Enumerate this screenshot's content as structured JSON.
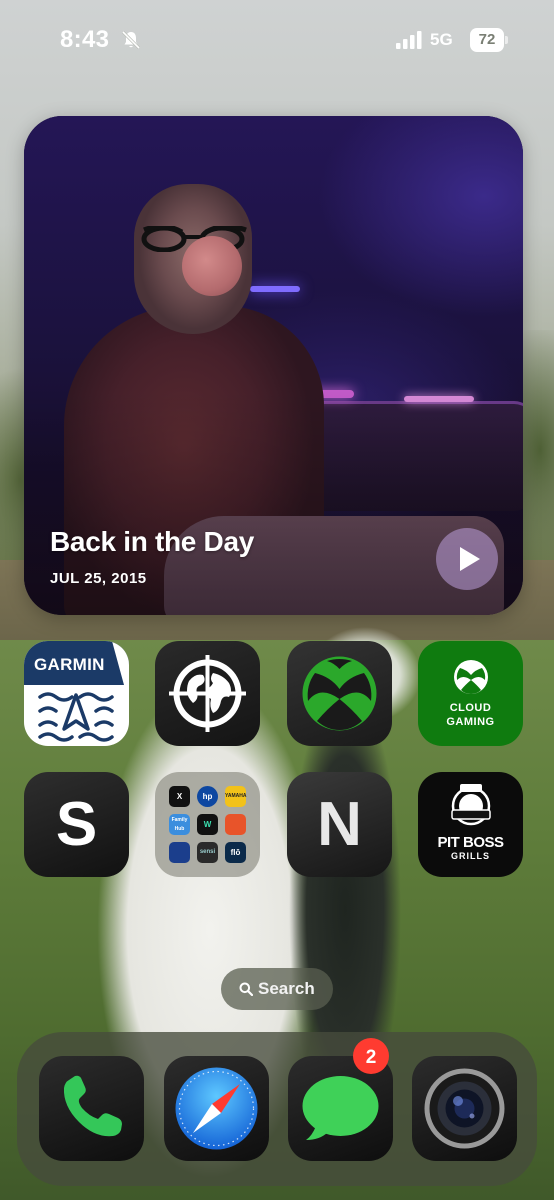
{
  "status_bar": {
    "time": "8:43",
    "network": "5G",
    "battery": "72",
    "silent_icon": "bell-slash-icon",
    "signal_icon": "cellular-signal-icon"
  },
  "photo_widget": {
    "title": "Back in the Day",
    "date": "JUL 25, 2015",
    "play_icon": "play-icon"
  },
  "apps": {
    "garmin": {
      "label": "GARMIN",
      "icon": "garmin-boating-icon",
      "color": "#1b3a67"
    },
    "globe": {
      "icon": "globe-crosshair-icon"
    },
    "xbox": {
      "icon": "xbox-icon",
      "color": "#107c10"
    },
    "cloud_gaming": {
      "line1": "CLOUD",
      "line2": "GAMING",
      "icon": "xbox-cloud-gaming-icon",
      "color": "#107c10"
    },
    "s_app": {
      "letter": "S"
    },
    "folder": {
      "icon": "app-folder-icon",
      "minis": [
        "X",
        "hp",
        "YAMAHA",
        "Family Hub",
        "W",
        "",
        "",
        "sensi",
        "flō"
      ]
    },
    "n_app": {
      "letter": "N"
    },
    "pitboss": {
      "line1": "PIT BOSS",
      "line2": "GRILLS",
      "icon": "pit-boss-badge-icon"
    }
  },
  "search": {
    "label": "Search",
    "icon": "search-icon"
  },
  "dock": {
    "phone": {
      "icon": "phone-icon"
    },
    "safari": {
      "icon": "safari-compass-icon"
    },
    "messages": {
      "icon": "messages-bubble-icon",
      "badge": "2"
    },
    "camera": {
      "icon": "camera-lens-icon"
    }
  },
  "colors": {
    "badge_red": "#ff3b30",
    "messages_green": "#3fd158",
    "phone_green": "#34c759"
  }
}
